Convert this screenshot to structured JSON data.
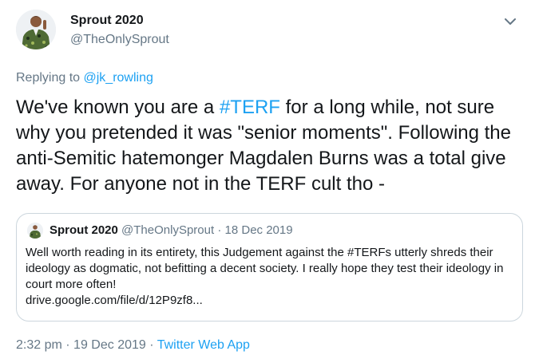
{
  "tweet": {
    "author": {
      "display_name": "Sprout 2020",
      "handle": "@TheOnlySprout"
    },
    "replying": {
      "prefix": "Replying to",
      "mention": "@jk_rowling"
    },
    "text": {
      "before": "We've known you are a ",
      "hashtag": "#TERF",
      "after": " for a long while, not sure why you pretended it was \"senior moments\". Following the anti-Semitic hatemonger Magdalen Burns was a total give away. For anyone not in the TERF cult tho -"
    },
    "quote": {
      "display_name": "Sprout 2020",
      "handle": "@TheOnlySprout",
      "separator": "·",
      "date": "18 Dec 2019",
      "text": "Well worth reading in its entirety, this Judgement against the #TERFs utterly shreds their ideology as dogmatic, not befitting a decent society. I really hope they test their ideology in court more often!",
      "link": "drive.google.com/file/d/12P9zf8..."
    },
    "footer": {
      "time": "2:32 pm",
      "separator": "·",
      "date": "19 Dec 2019",
      "source": "Twitter Web App"
    }
  },
  "icons": {
    "avatar": "avatar-photo",
    "menu": "chevron-down-icon"
  },
  "colors": {
    "link": "#1da1f2",
    "secondary_text": "#657786",
    "border": "#ccd6dd",
    "text": "#14171a"
  }
}
